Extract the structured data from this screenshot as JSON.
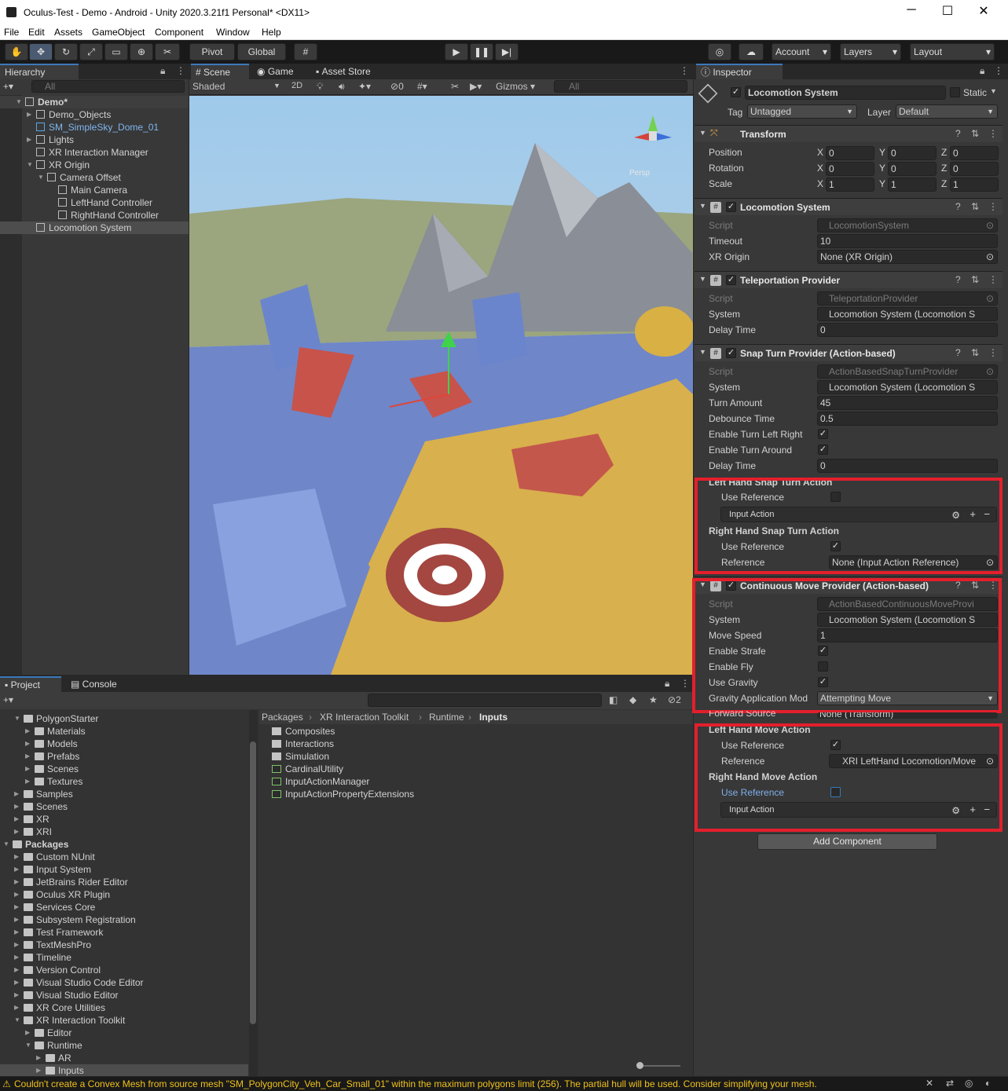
{
  "window": {
    "title": "Oculus-Test - Demo - Android - Unity 2020.3.21f1 Personal* <DX11>"
  },
  "menu": [
    "File",
    "Edit",
    "Assets",
    "GameObject",
    "Component",
    "Window",
    "Help"
  ],
  "toolbar": {
    "pivot": "Pivot",
    "global": "Global",
    "account": "Account",
    "layers": "Layers",
    "layout": "Layout"
  },
  "hierarchy": {
    "tab": "Hierarchy",
    "search_placeholder": "All",
    "items": [
      {
        "label": "Demo*",
        "indent": 0,
        "bold": true
      },
      {
        "label": "Demo_Objects",
        "indent": 1
      },
      {
        "label": "SM_SimpleSky_Dome_01",
        "indent": 1,
        "blue": true
      },
      {
        "label": "Lights",
        "indent": 1
      },
      {
        "label": "XR Interaction Manager",
        "indent": 1
      },
      {
        "label": "XR Origin",
        "indent": 1
      },
      {
        "label": "Camera Offset",
        "indent": 2
      },
      {
        "label": "Main Camera",
        "indent": 3
      },
      {
        "label": "LeftHand Controller",
        "indent": 3
      },
      {
        "label": "RightHand Controller",
        "indent": 3
      },
      {
        "label": "Locomotion System",
        "indent": 1,
        "selected": true
      }
    ]
  },
  "scene": {
    "tabs": [
      "Scene",
      "Game",
      "Asset Store"
    ],
    "shading": "Shaded",
    "mode2d": "2D",
    "hidden_count": "0",
    "gizmos": "Gizmos",
    "search_placeholder": "All",
    "persp_label": "Persp"
  },
  "project": {
    "tabs": [
      "Project",
      "Console"
    ],
    "hidden_count": "2",
    "breadcrumb": [
      "Packages",
      "XR Interaction Toolkit",
      "Runtime",
      "Inputs"
    ],
    "tree": [
      {
        "label": "PolygonStarter",
        "indent": 1
      },
      {
        "label": "Materials",
        "indent": 2
      },
      {
        "label": "Models",
        "indent": 2
      },
      {
        "label": "Prefabs",
        "indent": 2
      },
      {
        "label": "Scenes",
        "indent": 2
      },
      {
        "label": "Textures",
        "indent": 2
      },
      {
        "label": "Samples",
        "indent": 1
      },
      {
        "label": "Scenes",
        "indent": 1
      },
      {
        "label": "XR",
        "indent": 1
      },
      {
        "label": "XRI",
        "indent": 1
      },
      {
        "label": "Packages",
        "indent": 0,
        "bold": true
      },
      {
        "label": "Custom NUnit",
        "indent": 1
      },
      {
        "label": "Input System",
        "indent": 1
      },
      {
        "label": "JetBrains Rider Editor",
        "indent": 1
      },
      {
        "label": "Oculus XR Plugin",
        "indent": 1
      },
      {
        "label": "Services Core",
        "indent": 1
      },
      {
        "label": "Subsystem Registration",
        "indent": 1
      },
      {
        "label": "Test Framework",
        "indent": 1
      },
      {
        "label": "TextMeshPro",
        "indent": 1
      },
      {
        "label": "Timeline",
        "indent": 1
      },
      {
        "label": "Version Control",
        "indent": 1
      },
      {
        "label": "Visual Studio Code Editor",
        "indent": 1
      },
      {
        "label": "Visual Studio Editor",
        "indent": 1
      },
      {
        "label": "XR Core Utilities",
        "indent": 1
      },
      {
        "label": "XR Interaction Toolkit",
        "indent": 1
      },
      {
        "label": "Editor",
        "indent": 2
      },
      {
        "label": "Runtime",
        "indent": 2
      },
      {
        "label": "AR",
        "indent": 3
      },
      {
        "label": "Inputs",
        "indent": 3,
        "selected": true
      }
    ],
    "files": [
      {
        "label": "Composites",
        "type": "folder"
      },
      {
        "label": "Interactions",
        "type": "folder"
      },
      {
        "label": "Simulation",
        "type": "folder"
      },
      {
        "label": "CardinalUtility",
        "type": "script"
      },
      {
        "label": "InputActionManager",
        "type": "script"
      },
      {
        "label": "InputActionPropertyExtensions",
        "type": "script"
      }
    ]
  },
  "inspector": {
    "tab": "Inspector",
    "object_name": "Locomotion System",
    "static_label": "Static",
    "tag_label": "Tag",
    "tag": "Untagged",
    "layer_label": "Layer",
    "layer": "Default",
    "transform": {
      "title": "Transform",
      "rows": [
        {
          "label": "Position",
          "x": "0",
          "y": "0",
          "z": "0"
        },
        {
          "label": "Rotation",
          "x": "0",
          "y": "0",
          "z": "0"
        },
        {
          "label": "Scale",
          "x": "1",
          "y": "1",
          "z": "1"
        }
      ]
    },
    "locomotion": {
      "title": "Locomotion System",
      "script": "LocomotionSystem",
      "timeout": "10",
      "xr_origin": "None (XR Origin)"
    },
    "teleport": {
      "title": "Teleportation Provider",
      "script": "TeleportationProvider",
      "system": "Locomotion System (Locomotion S",
      "delay": "0"
    },
    "snap": {
      "title": "Snap Turn Provider (Action-based)",
      "script": "ActionBasedSnapTurnProvider",
      "system": "Locomotion System (Locomotion S",
      "turn_amount": "45",
      "debounce": "0.5",
      "delay": "0",
      "left_action_title": "Left Hand Snap Turn Action",
      "right_action_title": "Right Hand Snap Turn Action",
      "use_reference": "Use Reference",
      "input_action": "Input Action",
      "reference_label": "Reference",
      "right_reference": "None (Input Action Reference)"
    },
    "labels": {
      "script": "Script",
      "system": "System",
      "timeout": "Timeout",
      "xr_origin": "XR Origin",
      "delay_time": "Delay Time",
      "turn_amount": "Turn Amount",
      "debounce_time": "Debounce Time",
      "enable_turn_lr": "Enable Turn Left Right",
      "enable_turn_around": "Enable Turn Around",
      "move_speed": "Move Speed",
      "enable_strafe": "Enable Strafe",
      "enable_fly": "Enable Fly",
      "use_gravity": "Use Gravity",
      "gravity_mode": "Gravity Application Mod",
      "forward_source": "Forward Source"
    },
    "move": {
      "title": "Continuous Move Provider (Action-based)",
      "script": "ActionBasedContinuousMoveProvi",
      "system": "Locomotion System (Locomotion S",
      "speed": "1",
      "gravity_mode": "Attempting Move",
      "forward_source": "None (Transform)",
      "left_action_title": "Left Hand Move Action",
      "left_reference": "XRI LeftHand Locomotion/Move",
      "right_action_title": "Right Hand Move Action"
    },
    "add_component": "Add Component"
  },
  "status": {
    "message": "Couldn't create a Convex Mesh from source mesh \"SM_PolygonCity_Veh_Car_Small_01\" within the maximum polygons limit (256). The partial hull will be used. Consider simplifying your mesh."
  }
}
